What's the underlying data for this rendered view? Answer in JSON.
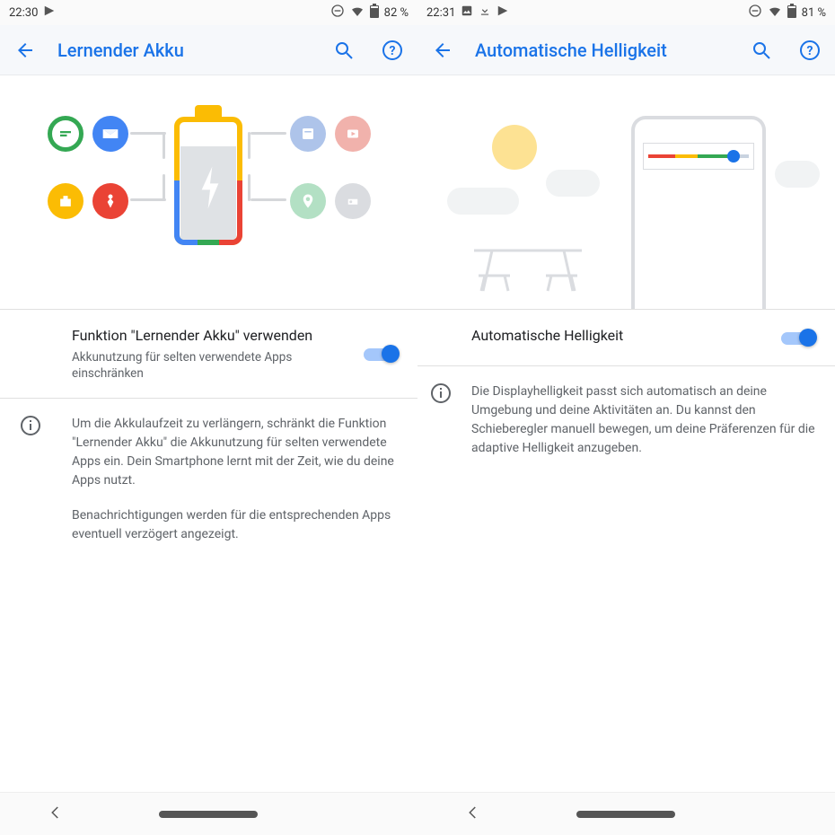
{
  "left": {
    "status": {
      "time": "22:30",
      "battery_pct": "82 %"
    },
    "appbar": {
      "title": "Lernender Akku"
    },
    "setting": {
      "title": "Funktion \"Lernender Akku\" verwenden",
      "subtitle": "Akkunutzung für selten verwendete Apps einschränken",
      "enabled": true
    },
    "info": {
      "p1": "Um die Akkulaufzeit zu verlängern, schränkt die Funktion \"Lernender Akku\" die Akkunutzung für selten verwendete Apps ein. Dein Smartphone lernt mit der Zeit, wie du deine Apps nutzt.",
      "p2": "Benachrichtigungen werden für die entsprechenden Apps eventuell verzögert angezeigt."
    }
  },
  "right": {
    "status": {
      "time": "22:31",
      "battery_pct": "81 %"
    },
    "appbar": {
      "title": "Automatische Helligkeit"
    },
    "setting": {
      "title": "Automatische Helligkeit",
      "enabled": true
    },
    "info": {
      "p1": "Die Displayhelligkeit passt sich automatisch an deine Umgebung und deine Aktivitäten an. Du kannst den Schieberegler manuell bewegen, um deine Präferenzen für die adaptive Helligkeit anzugeben."
    }
  },
  "colors": {
    "accent": "#1a73e8",
    "green": "#34a853",
    "blue": "#4285f4",
    "red": "#ea4335",
    "yellow": "#fbbc04",
    "grey": "#dadce0"
  }
}
